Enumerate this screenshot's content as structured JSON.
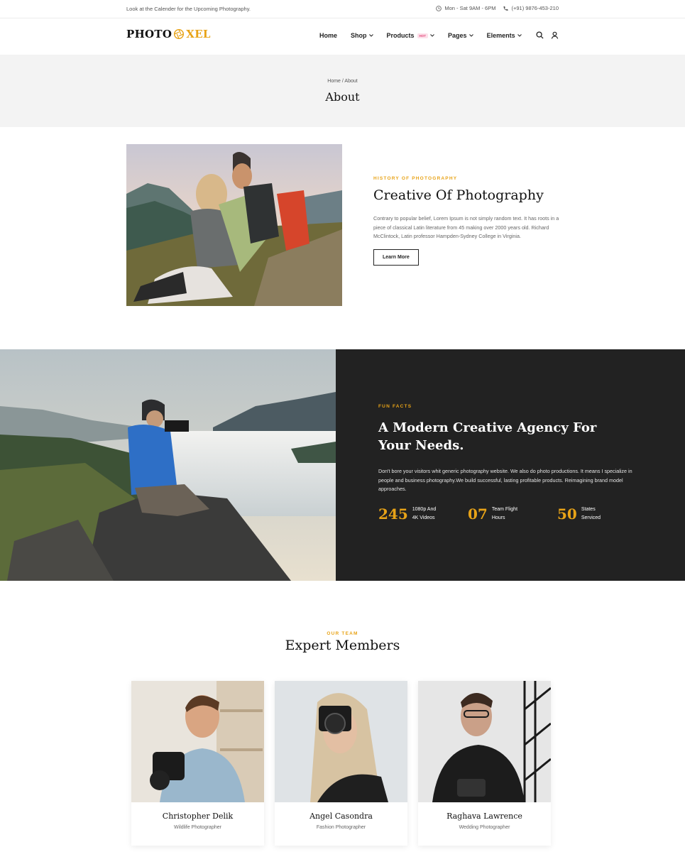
{
  "topbar": {
    "message": "Look at the Calender for the Upcoming Photography.",
    "hours": "Mon - Sat 9AM - 6PM",
    "phone": "(+91) 9876-453-210"
  },
  "logo": {
    "part1": "PHOTO",
    "part2": "XEL"
  },
  "nav": {
    "home": "Home",
    "shop": "Shop",
    "products": "Products",
    "hot_badge": "HOT",
    "pages": "Pages",
    "elements": "Elements"
  },
  "page_title": {
    "breadcrumb": "Home / About",
    "title": "About"
  },
  "about": {
    "eyebrow": "HISTORY OF PHOTOGRAPHY",
    "title": "Creative Of Photography",
    "body": "Contrary to popular belief, Lorem Ipsum is not simply random text. It has roots in a piece of classical Latin literature from 45 making over 2000 years old. Richard McClintock, Latin professor Hampden-Sydney College in Virginia.",
    "button": "Learn More"
  },
  "fun_facts": {
    "eyebrow": "FUN FACTS",
    "title": "A Modern Creative Agency For Your Needs.",
    "body": "Don't bore your visitors whit generic photography website. We also do photo productions. It means I specialize in people and business photography.We build successful, lasting profitable products. Reimagining brand model approaches.",
    "stats": [
      {
        "number": "245",
        "label": "1080p And\n4K Videos"
      },
      {
        "number": "07",
        "label": "Team Flight\nHours"
      },
      {
        "number": "50",
        "label": "States\nServiced"
      }
    ]
  },
  "team": {
    "eyebrow": "OUR TEAM",
    "title": "Expert Members",
    "members": [
      {
        "name": "Christopher Delik",
        "role": "Wildlife Photographer"
      },
      {
        "name": "Angel Casondra",
        "role": "Fashion Photographer"
      },
      {
        "name": "Raghava Lawrence",
        "role": "Wedding Photographer"
      }
    ]
  },
  "colors": {
    "accent": "#e8a317",
    "dark_panel": "#222222",
    "title_band": "#f3f3f3"
  }
}
